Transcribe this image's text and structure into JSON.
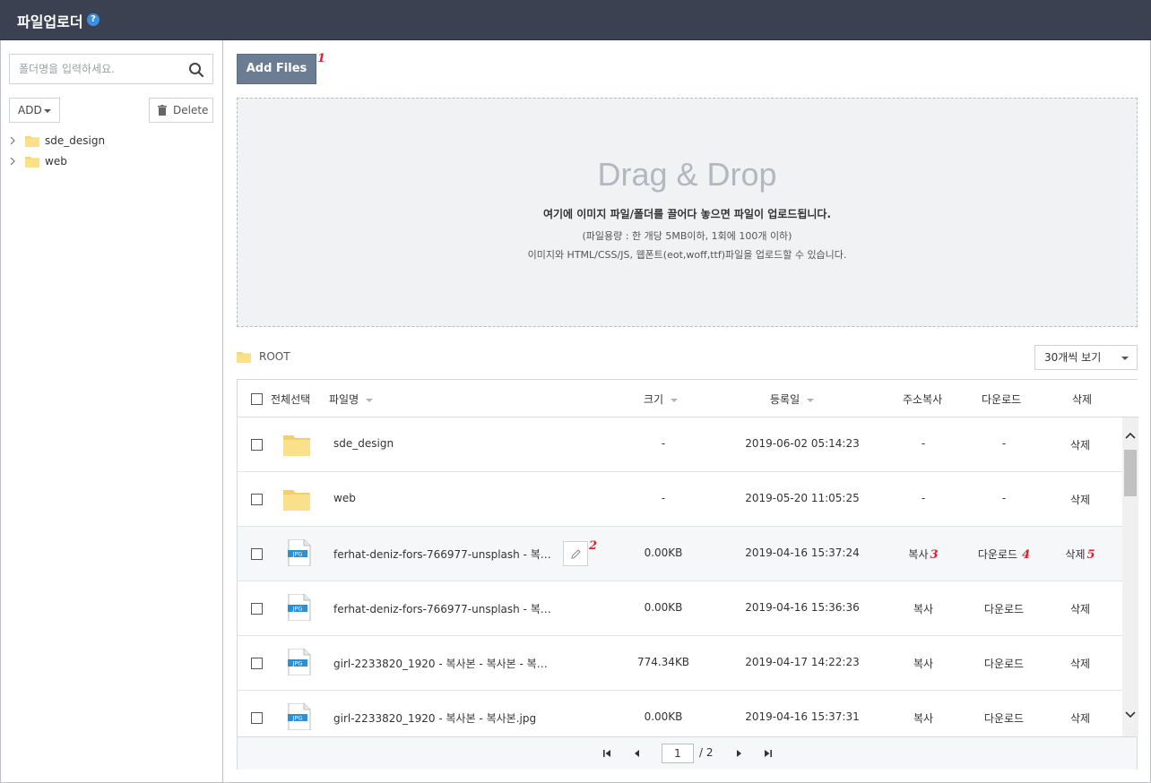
{
  "app": {
    "title": "파일업로더",
    "help_icon": "?"
  },
  "sidebar": {
    "search_placeholder": "폴더명을 입력하세요.",
    "add_label": "ADD",
    "delete_label": "Delete",
    "tree": [
      {
        "label": "sde_design"
      },
      {
        "label": "web"
      }
    ]
  },
  "toolbar": {
    "add_files_label": "Add Files"
  },
  "markers": {
    "m1": "1",
    "m2": "2",
    "m3": "3",
    "m4": "4",
    "m5": "5"
  },
  "dropzone": {
    "title": "Drag & Drop",
    "main": "여기에 이미지 파일/폴더를 끌어다 놓으면 파일이 업로드됩니다.",
    "sub1": "(파일용량 : 한 개당 5MB이하, 1회에 100개 이하)",
    "sub2": "이미지와 HTML/CSS/JS, 웹폰트(eot,woff,ttf)파일을 업로드할 수 있습니다."
  },
  "path": {
    "label": "ROOT"
  },
  "per_page": {
    "selected": "30개씩 보기"
  },
  "table": {
    "headers": {
      "select_all": "전체선택",
      "name": "파일명",
      "size": "크기",
      "date": "등록일",
      "copy": "주소복사",
      "download": "다운로드",
      "delete": "삭제"
    },
    "rows": [
      {
        "type": "folder",
        "name": "sde_design",
        "size": "-",
        "date": "2019-06-02 05:14:23",
        "copy": "-",
        "download": "-",
        "delete": "삭제"
      },
      {
        "type": "folder",
        "name": "web",
        "size": "-",
        "date": "2019-05-20 11:05:25",
        "copy": "-",
        "download": "-",
        "delete": "삭제"
      },
      {
        "type": "jpg",
        "name": "ferhat-deniz-fors-766977-unsplash - 복…",
        "size": "0.00KB",
        "date": "2019-04-16 15:37:24",
        "copy": "복사",
        "download": "다운로드",
        "delete": "삭제"
      },
      {
        "type": "jpg",
        "name": "ferhat-deniz-fors-766977-unsplash - 복…",
        "size": "0.00KB",
        "date": "2019-04-16 15:36:36",
        "copy": "복사",
        "download": "다운로드",
        "delete": "삭제"
      },
      {
        "type": "jpg",
        "name": "girl-2233820_1920 - 복사본 - 복사본 - 복…",
        "size": "774.34KB",
        "date": "2019-04-17 14:22:23",
        "copy": "복사",
        "download": "다운로드",
        "delete": "삭제"
      },
      {
        "type": "jpg",
        "name": "girl-2233820_1920 - 복사본 - 복사본.jpg",
        "size": "0.00KB",
        "date": "2019-04-16 15:37:31",
        "copy": "복사",
        "download": "다운로드",
        "delete": "삭제"
      }
    ],
    "file_badge": "JPG"
  },
  "pagination": {
    "current": "1",
    "total": "/ 2"
  }
}
